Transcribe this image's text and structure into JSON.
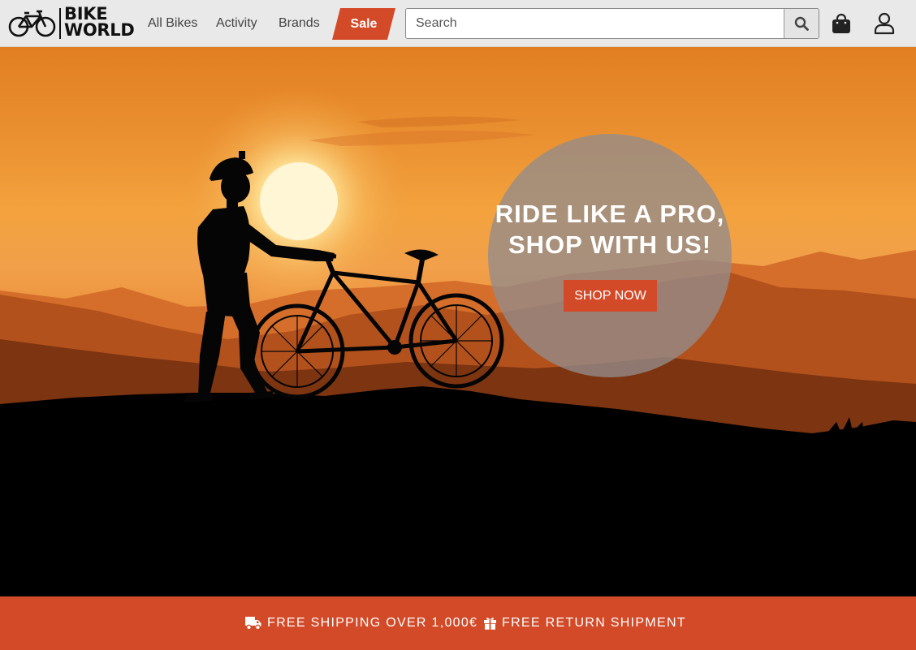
{
  "header": {
    "logo": {
      "line1": "BIKE",
      "line2": "WORLD"
    },
    "nav": [
      {
        "label": "All Bikes"
      },
      {
        "label": "Activity"
      },
      {
        "label": "Brands"
      }
    ],
    "sale_label": "Sale",
    "search": {
      "placeholder": "Search",
      "value": "",
      "icon": "search-icon"
    },
    "icons": {
      "cart": "shopping-bag-icon",
      "account": "user-icon"
    }
  },
  "hero": {
    "headline_line1": "RIDE LIKE A PRO,",
    "headline_line2": "SHOP WITH US!",
    "cta_label": "SHOP NOW",
    "image": "silhouette of cyclist with mountain bike at sunset over mountains"
  },
  "benefits": [
    {
      "icon": "truck-icon",
      "text": "FREE SHIPPING OVER 1,000€"
    },
    {
      "icon": "gift-icon",
      "text": "FREE RETURN SHIPMENT"
    }
  ],
  "colors": {
    "accent": "#d34a28",
    "header_bg": "#e9e9e9",
    "nav_text": "#444444",
    "promo_circle": "#948c8a"
  }
}
